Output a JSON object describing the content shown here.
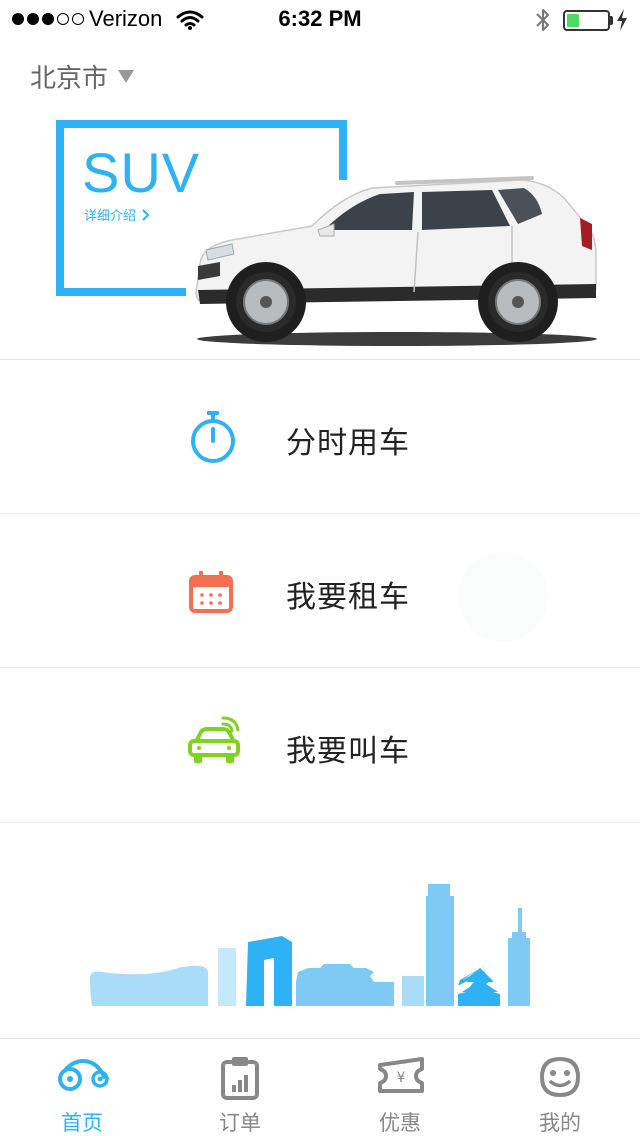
{
  "status_bar": {
    "carrier": "Verizon",
    "time": "6:32 PM",
    "battery_level": 0.3
  },
  "header": {
    "city": "北京市"
  },
  "hero": {
    "title": "SUV",
    "detail_link": "详细介绍"
  },
  "menu": {
    "items": [
      {
        "label": "分时用车",
        "icon": "stopwatch-icon",
        "color": "#2fb1f5"
      },
      {
        "label": "我要租车",
        "icon": "calendar-icon",
        "color": "#f26f4f"
      },
      {
        "label": "我要叫车",
        "icon": "car-signal-icon",
        "color": "#7ed321"
      }
    ]
  },
  "tab_bar": {
    "tabs": [
      {
        "label": "首页",
        "icon": "home-bike-icon",
        "active": true
      },
      {
        "label": "订单",
        "icon": "clipboard-chart-icon",
        "active": false
      },
      {
        "label": "优惠",
        "icon": "coupon-yen-icon",
        "active": false
      },
      {
        "label": "我的",
        "icon": "smiley-face-icon",
        "active": false
      }
    ]
  },
  "colors": {
    "accent": "#2fb1f5",
    "skyline_light": "#a9dcf8",
    "skyline_dark": "#2fb1f5",
    "tab_inactive": "#888888"
  }
}
